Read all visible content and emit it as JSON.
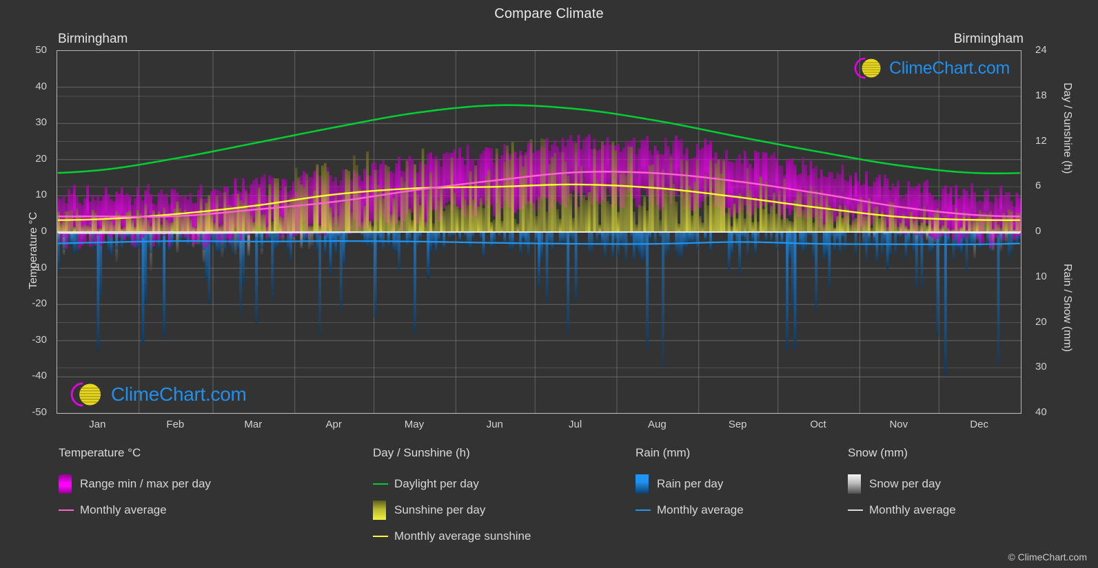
{
  "title": "Compare Climate",
  "station_left": "Birmingham",
  "station_right": "Birmingham",
  "copyright": "© ClimeChart.com",
  "watermark_text": "ClimeChart.com",
  "axes": {
    "left_title": "Temperature °C",
    "right_top_title": "Day / Sunshine (h)",
    "right_bottom_title": "Rain / Snow (mm)",
    "temp_ticks": [
      50,
      40,
      30,
      20,
      10,
      0,
      -10,
      -20,
      -30,
      -40,
      -50
    ],
    "day_ticks": [
      24,
      18,
      12,
      6,
      0
    ],
    "rain_ticks": [
      0,
      10,
      20,
      30,
      40
    ],
    "months": [
      "Jan",
      "Feb",
      "Mar",
      "Apr",
      "May",
      "Jun",
      "Jul",
      "Aug",
      "Sep",
      "Oct",
      "Nov",
      "Dec"
    ]
  },
  "legend": {
    "temperature": {
      "heading": "Temperature °C",
      "items": [
        {
          "label": "Range min / max per day",
          "marker": "gradient-box",
          "color": "#ff00ff"
        },
        {
          "label": "Monthly average",
          "marker": "line",
          "color": "#ff66cc"
        }
      ]
    },
    "day_sunshine": {
      "heading": "Day / Sunshine (h)",
      "items": [
        {
          "label": "Daylight per day",
          "marker": "line",
          "color": "#00cc33"
        },
        {
          "label": "Sunshine per day",
          "marker": "gradient-box",
          "color": "#f2f23d"
        },
        {
          "label": "Monthly average sunshine",
          "marker": "line",
          "color": "#ffff33"
        }
      ]
    },
    "rain": {
      "heading": "Rain (mm)",
      "items": [
        {
          "label": "Rain per day",
          "marker": "gradient-box",
          "color": "#1f90f0"
        },
        {
          "label": "Monthly average",
          "marker": "line",
          "color": "#2196f3"
        }
      ]
    },
    "snow": {
      "heading": "Snow (mm)",
      "items": [
        {
          "label": "Snow per day",
          "marker": "gradient-box",
          "color": "#e8e8e8"
        },
        {
          "label": "Monthly average",
          "marker": "line",
          "color": "#dddddd"
        }
      ]
    }
  },
  "colors": {
    "background": "#333333",
    "grid": "#8c8c8c",
    "axis": "#b7b7b7",
    "temp_range": "#ff00ff",
    "temp_avg": "#ff66cc",
    "daylight": "#00cc33",
    "sunshine": "#f2f23d",
    "sunshine_avg": "#ffff33",
    "rain": "#1f90f0",
    "rain_avg": "#2196f3",
    "snow": "#e8e8e8",
    "brand_blue": "#1f90f0",
    "brand_magenta": "#e800e8",
    "brand_yellow": "#e8d820"
  },
  "chart_data": {
    "type": "line",
    "title": "Compare Climate",
    "subtitle": "Birmingham",
    "xlabel": "",
    "ylabel": "Temperature °C",
    "y2label_top": "Day / Sunshine (h)",
    "y2label_bottom": "Rain / Snow (mm)",
    "ylim": [
      -50,
      50
    ],
    "y2lim_day": [
      0,
      24
    ],
    "y2lim_rain": [
      0,
      40
    ],
    "grid": true,
    "legend_position": "below",
    "categories": [
      "Jan",
      "Feb",
      "Mar",
      "Apr",
      "May",
      "Jun",
      "Jul",
      "Aug",
      "Sep",
      "Oct",
      "Nov",
      "Dec"
    ],
    "series": [
      {
        "name": "Monthly average temperature",
        "unit": "°C",
        "color": "#ff66cc",
        "values": [
          4.3,
          4.4,
          6.2,
          8.4,
          11.6,
          14.3,
          16.5,
          16.2,
          13.9,
          10.6,
          6.9,
          4.6
        ]
      },
      {
        "name": "Monthly average max temperature",
        "unit": "°C",
        "color": "#ff00ff",
        "values": [
          7.0,
          7.5,
          10.0,
          13.0,
          16.5,
          19.3,
          21.5,
          21.0,
          18.3,
          14.2,
          10.0,
          7.3
        ]
      },
      {
        "name": "Monthly average min temperature",
        "unit": "°C",
        "color": "#ff00ff",
        "values": [
          1.5,
          1.3,
          2.5,
          4.0,
          6.8,
          9.6,
          11.7,
          11.5,
          9.6,
          7.0,
          3.8,
          1.9
        ]
      },
      {
        "name": "Daylight per day",
        "unit": "h",
        "color": "#00cc33",
        "values": [
          8.2,
          9.8,
          11.8,
          13.9,
          15.8,
          16.8,
          16.3,
          14.7,
          12.6,
          10.6,
          8.8,
          7.8
        ]
      },
      {
        "name": "Monthly average sunshine",
        "unit": "h",
        "color": "#ffff33",
        "values": [
          1.7,
          2.4,
          3.5,
          5.0,
          5.8,
          6.0,
          6.3,
          5.8,
          4.6,
          3.2,
          2.0,
          1.6
        ]
      },
      {
        "name": "Monthly average rain",
        "unit": "mm",
        "color": "#2196f3",
        "values": [
          2.3,
          2.0,
          2.1,
          2.0,
          2.1,
          2.4,
          2.6,
          2.6,
          2.2,
          2.6,
          2.7,
          2.7
        ]
      },
      {
        "name": "Monthly average snow",
        "unit": "mm",
        "color": "#dddddd",
        "values": [
          0.3,
          0.3,
          0.2,
          0.1,
          0.0,
          0.0,
          0.0,
          0.0,
          0.0,
          0.0,
          0.1,
          0.2
        ]
      }
    ]
  }
}
